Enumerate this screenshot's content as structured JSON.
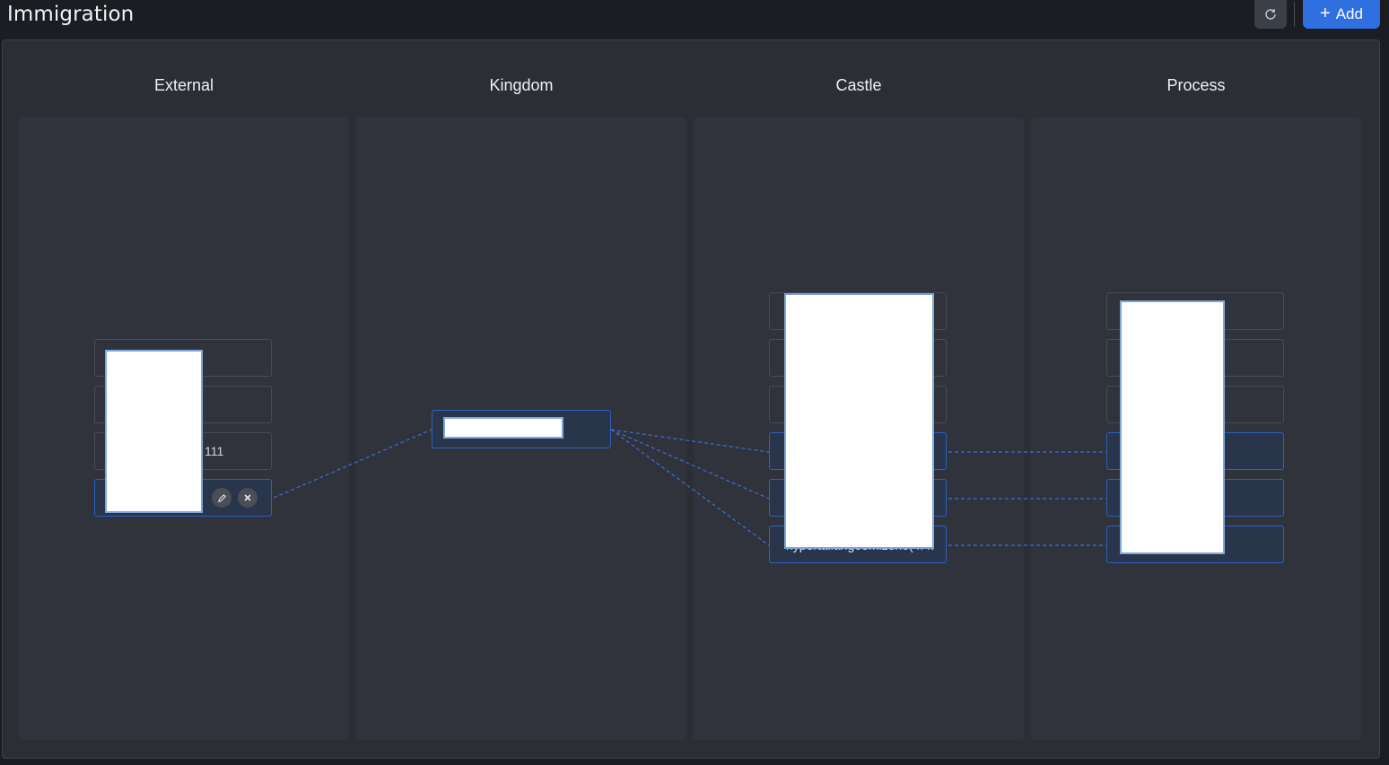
{
  "header": {
    "title": "Immigration",
    "add_label": "Add",
    "refresh_icon": "refresh-icon",
    "plus_icon": "plus-icon"
  },
  "columns": [
    {
      "label": "External"
    },
    {
      "label": "Kingdom"
    },
    {
      "label": "Castle"
    },
    {
      "label": "Process"
    }
  ],
  "external": {
    "nodes": [
      {
        "text": ""
      },
      {
        "text": ""
      },
      {
        "text": "111"
      },
      {
        "text": ""
      }
    ],
    "edit_icon": "pencil-icon",
    "delete_icon": "close-icon"
  },
  "castle": {
    "partial_label": "hypertallangeomizone(4.4..."
  },
  "colors": {
    "accent": "#2f6fe0",
    "link": "#3b6fd8",
    "background": "#1b1d22",
    "lane": "#30333b"
  }
}
